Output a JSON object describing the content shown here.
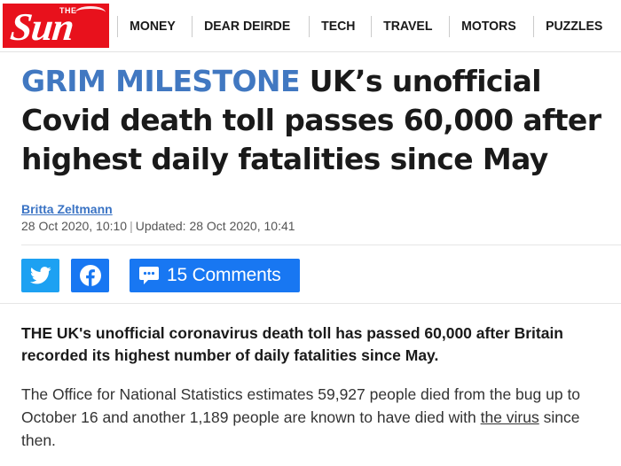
{
  "brand": {
    "logo_small": "THE",
    "logo_word": "Sun",
    "color": "#e8111c"
  },
  "nav": {
    "items": [
      {
        "label": "MONEY"
      },
      {
        "label": "DEAR DEIRDE"
      },
      {
        "label": "TECH"
      },
      {
        "label": "TRAVEL"
      },
      {
        "label": "MOTORS"
      },
      {
        "label": "PUZZLES"
      }
    ]
  },
  "article": {
    "kicker": "GRIM MILESTONE",
    "headline": "UK’s unofficial Covid death toll passes 60,000 after highest daily fatalities since May",
    "kicker_color": "#4178c1",
    "author": "Britta Zeltmann",
    "published": "28 Oct 2020, 10:10",
    "separator": "|",
    "updated": "Updated: 28 Oct 2020, 10:41",
    "standfirst": "THE UK's unofficial coronavirus death toll has passed 60,000 after Britain recorded its highest number of daily fatalities since May.",
    "para1_before": "The Office for National Statistics estimates 59,927 people died from the bug up to October 16 and another 1,189 people are known to have died with ",
    "para1_link": "the virus",
    "para1_after": " since then."
  },
  "share": {
    "twitter_icon": "twitter-bird-icon",
    "facebook_icon": "facebook-f-icon",
    "comments_label": "15 Comments",
    "twitter_color": "#1da1f2",
    "facebook_color": "#1877f2"
  }
}
